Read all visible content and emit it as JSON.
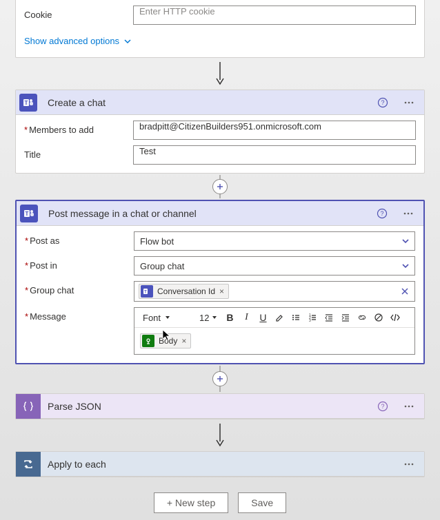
{
  "http_card": {
    "cookie_label": "Cookie",
    "cookie_placeholder": "Enter HTTP cookie",
    "advanced_link": "Show advanced options"
  },
  "create_chat": {
    "title": "Create a chat",
    "members_label": "Members to add",
    "members_value": "bradpitt@CitizenBuilders951.onmicrosoft.com",
    "title_label": "Title",
    "title_value": "Test"
  },
  "post_message": {
    "title": "Post message in a chat or channel",
    "post_as_label": "Post as",
    "post_as_value": "Flow bot",
    "post_in_label": "Post in",
    "post_in_value": "Group chat",
    "group_chat_label": "Group chat",
    "group_chat_token": "Conversation Id",
    "message_label": "Message",
    "toolbar": {
      "font": "Font",
      "size": "12"
    },
    "body_token": "Body"
  },
  "parse_json": {
    "title": "Parse JSON"
  },
  "apply_each": {
    "title": "Apply to each"
  },
  "footer": {
    "new_step": "+ New step",
    "save": "Save"
  }
}
